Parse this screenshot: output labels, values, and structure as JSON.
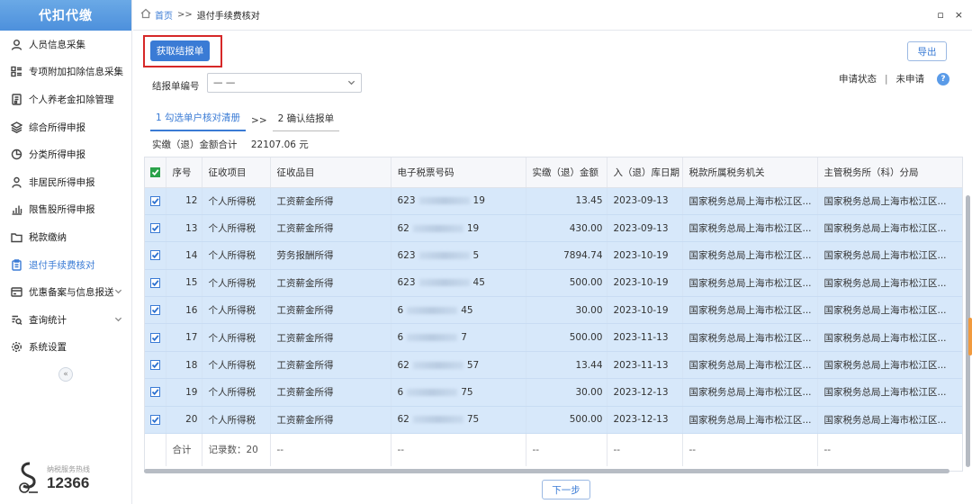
{
  "sidebar": {
    "header": "代扣代缴",
    "items": [
      {
        "label": "人员信息采集",
        "icon": "user-icon",
        "active": false,
        "has_children": false
      },
      {
        "label": "专项附加扣除信息采集",
        "icon": "list-icon",
        "active": false,
        "has_children": false
      },
      {
        "label": "个人养老金扣除管理",
        "icon": "document-icon",
        "active": false,
        "has_children": false
      },
      {
        "label": "综合所得申报",
        "icon": "layers-icon",
        "active": false,
        "has_children": false
      },
      {
        "label": "分类所得申报",
        "icon": "pie-icon",
        "active": false,
        "has_children": false
      },
      {
        "label": "非居民所得申报",
        "icon": "person-icon",
        "active": false,
        "has_children": false
      },
      {
        "label": "限售股所得申报",
        "icon": "bar-chart-icon",
        "active": false,
        "has_children": false
      },
      {
        "label": "税款缴纳",
        "icon": "folder-icon",
        "active": false,
        "has_children": false
      },
      {
        "label": "退付手续费核对",
        "icon": "clipboard-icon",
        "active": true,
        "has_children": false
      },
      {
        "label": "优惠备案与信息报送",
        "icon": "card-icon",
        "active": false,
        "has_children": true
      },
      {
        "label": "查询统计",
        "icon": "query-icon",
        "active": false,
        "has_children": true
      },
      {
        "label": "系统设置",
        "icon": "gear-icon",
        "active": false,
        "has_children": false
      }
    ],
    "collapse_glyph": "«",
    "hotline_label": "纳税服务热线",
    "hotline_number": "12366"
  },
  "breadcrumb": {
    "home": "首页",
    "separator": ">>",
    "current": "退付手续费核对"
  },
  "window_controls": {
    "restore": "▫",
    "close": "×"
  },
  "toolbar": {
    "fetch_label": "获取结报单",
    "export_label": "导出"
  },
  "status": {
    "label": "申请状态",
    "separator": "|",
    "value": "未申请"
  },
  "form": {
    "report_no_label": "结报单编号",
    "report_no_value": "— —"
  },
  "steps": {
    "step1": "1 勾选单户核对清册",
    "separator": ">>",
    "step2": "2 确认结报单"
  },
  "totals": {
    "label": "实缴（退）金额合计",
    "amount": "22107.06 元"
  },
  "table": {
    "headers": [
      "序号",
      "征收项目",
      "征收品目",
      "电子税票号码",
      "实缴（退）金额",
      "入（退）库日期",
      "税款所属税务机关",
      "主管税务所（科）分局"
    ],
    "rows": [
      {
        "seq": "12",
        "item": "个人所得税",
        "sub": "工资薪金所得",
        "ticket_start": "623",
        "ticket_end": "19",
        "amount": "13.45",
        "date": "2023-09-13",
        "org": "国家税务总局上海市松江区...",
        "branch": "国家税务总局上海市松江区..."
      },
      {
        "seq": "13",
        "item": "个人所得税",
        "sub": "工资薪金所得",
        "ticket_start": "62",
        "ticket_end": "19",
        "amount": "430.00",
        "date": "2023-09-13",
        "org": "国家税务总局上海市松江区...",
        "branch": "国家税务总局上海市松江区..."
      },
      {
        "seq": "14",
        "item": "个人所得税",
        "sub": "劳务报酬所得",
        "ticket_start": "623",
        "ticket_end": "5",
        "amount": "7894.74",
        "date": "2023-10-19",
        "org": "国家税务总局上海市松江区...",
        "branch": "国家税务总局上海市松江区..."
      },
      {
        "seq": "15",
        "item": "个人所得税",
        "sub": "工资薪金所得",
        "ticket_start": "623",
        "ticket_end": "45",
        "amount": "500.00",
        "date": "2023-10-19",
        "org": "国家税务总局上海市松江区...",
        "branch": "国家税务总局上海市松江区..."
      },
      {
        "seq": "16",
        "item": "个人所得税",
        "sub": "工资薪金所得",
        "ticket_start": "6",
        "ticket_end": "45",
        "amount": "30.00",
        "date": "2023-10-19",
        "org": "国家税务总局上海市松江区...",
        "branch": "国家税务总局上海市松江区..."
      },
      {
        "seq": "17",
        "item": "个人所得税",
        "sub": "工资薪金所得",
        "ticket_start": "6",
        "ticket_end": "7",
        "amount": "500.00",
        "date": "2023-11-13",
        "org": "国家税务总局上海市松江区...",
        "branch": "国家税务总局上海市松江区..."
      },
      {
        "seq": "18",
        "item": "个人所得税",
        "sub": "工资薪金所得",
        "ticket_start": "62",
        "ticket_end": "57",
        "amount": "13.44",
        "date": "2023-11-13",
        "org": "国家税务总局上海市松江区...",
        "branch": "国家税务总局上海市松江区..."
      },
      {
        "seq": "19",
        "item": "个人所得税",
        "sub": "工资薪金所得",
        "ticket_start": "6",
        "ticket_end": "75",
        "amount": "30.00",
        "date": "2023-12-13",
        "org": "国家税务总局上海市松江区...",
        "branch": "国家税务总局上海市松江区..."
      },
      {
        "seq": "20",
        "item": "个人所得税",
        "sub": "工资薪金所得",
        "ticket_start": "62",
        "ticket_end": "75",
        "amount": "500.00",
        "date": "2023-12-13",
        "org": "国家税务总局上海市松江区...",
        "branch": "国家税务总局上海市松江区..."
      }
    ],
    "summary": {
      "label": "合计",
      "count": "记录数：20",
      "placeholder": "--"
    }
  },
  "footer": {
    "next_label": "下一步"
  },
  "colors": {
    "accent": "#3a7bd5",
    "selected_row": "#d7e8fa",
    "highlight_border": "#d62828",
    "checkbox_header": "#2aa24a"
  }
}
